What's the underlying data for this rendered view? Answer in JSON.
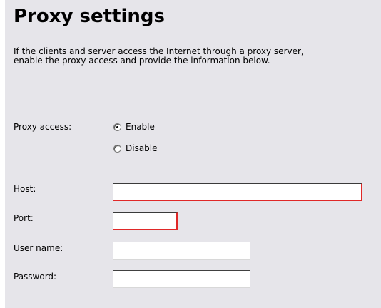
{
  "page": {
    "title": "Proxy settings",
    "description_lines": [
      "If the clients and server access the Internet through a proxy server,",
      "enable the proxy access and provide the information below."
    ]
  },
  "proxy_access": {
    "label": "Proxy access:",
    "options": [
      {
        "label": "Enable",
        "checked": true
      },
      {
        "label": "Disable",
        "checked": false
      }
    ]
  },
  "fields": {
    "host": {
      "label": "Host:",
      "value": "",
      "error": true
    },
    "port": {
      "label": "Port:",
      "value": "",
      "error": true
    },
    "username": {
      "label": "User name:",
      "value": "",
      "error": false
    },
    "password": {
      "label": "Password:",
      "value": "",
      "error": false
    }
  },
  "colors": {
    "panel_background": "#e6e5ea",
    "error_border": "#e02828"
  }
}
